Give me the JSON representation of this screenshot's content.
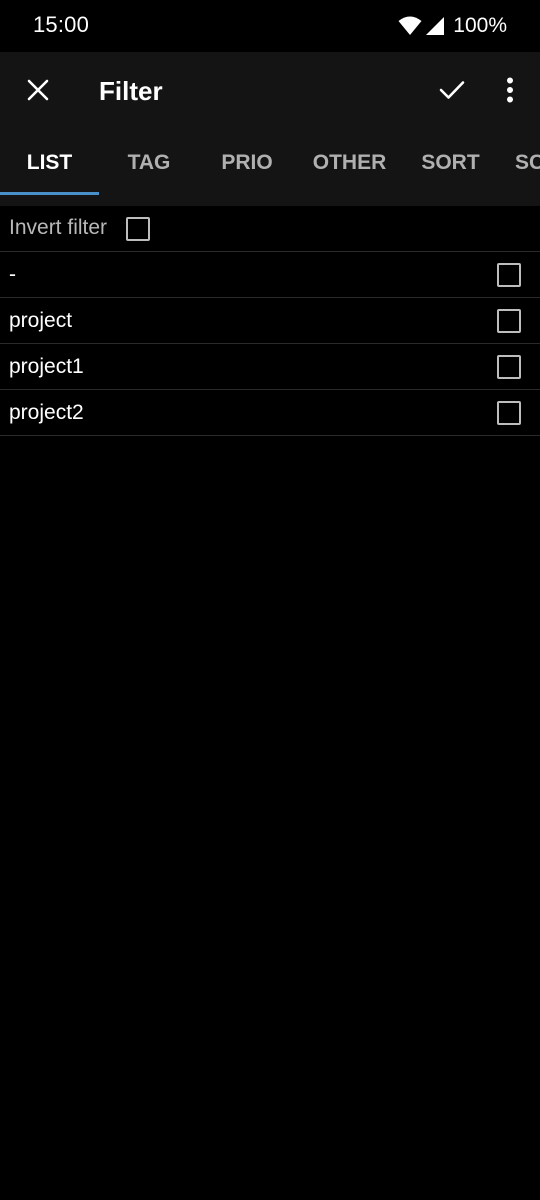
{
  "status_bar": {
    "time": "15:00",
    "battery": "100%",
    "icons": [
      "wifi-icon",
      "signal-icon"
    ]
  },
  "toolbar": {
    "title": "Filter",
    "icons": [
      "close-icon",
      "check-icon",
      "more-vert-icon"
    ]
  },
  "tabs": [
    {
      "label": "LIST",
      "active": true
    },
    {
      "label": "TAG",
      "active": false
    },
    {
      "label": "PRIO",
      "active": false
    },
    {
      "label": "OTHER",
      "active": false
    },
    {
      "label": "SORT",
      "active": false
    },
    {
      "label": "SC",
      "active": false
    }
  ],
  "invert_filter": {
    "label": "Invert filter",
    "checked": false
  },
  "lists": [
    {
      "label": "-",
      "checked": false
    },
    {
      "label": "project",
      "checked": false
    },
    {
      "label": "project1",
      "checked": false
    },
    {
      "label": "project2",
      "checked": false
    }
  ],
  "colors": {
    "accent": "#4a90c8",
    "app_bar": "#141414",
    "background": "#000000"
  }
}
